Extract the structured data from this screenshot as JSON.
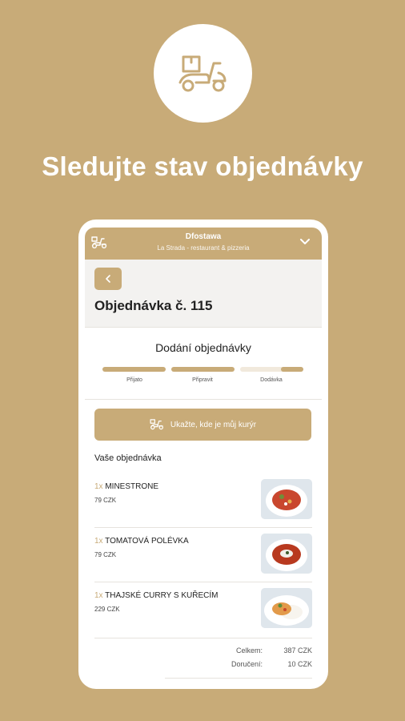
{
  "hero": {
    "icon": "delivery-scooter-icon",
    "title": "Sledujte stav objednávky"
  },
  "app_header": {
    "title": "Dfostawa",
    "subtitle": "La Strada - restaurant & pizzeria"
  },
  "order": {
    "title": "Objednávka č. 115"
  },
  "delivery": {
    "title": "Dodání objednávky",
    "steps": [
      "Přijato",
      "Připravit",
      "Dodávka"
    ]
  },
  "courier_button": {
    "label": "Ukažte, kde je můj kurýr"
  },
  "items_section": {
    "title": "Vaše objednávka",
    "items": [
      {
        "qty": "1x",
        "name": "MINESTRONE",
        "price": "79 CZK"
      },
      {
        "qty": "1x",
        "name": "TOMATOVÁ POLÉVKA",
        "price": "79 CZK"
      },
      {
        "qty": "1x",
        "name": "THAJSKÉ CURRY S KUŘECÍM",
        "price": "229 CZK"
      }
    ]
  },
  "totals": {
    "total_label": "Celkem:",
    "total_value": "387 CZK",
    "delivery_label": "Doručení:",
    "delivery_value": "10 CZK"
  },
  "colors": {
    "brand": "#c8ab78",
    "brand_light": "#f1e9dc"
  }
}
